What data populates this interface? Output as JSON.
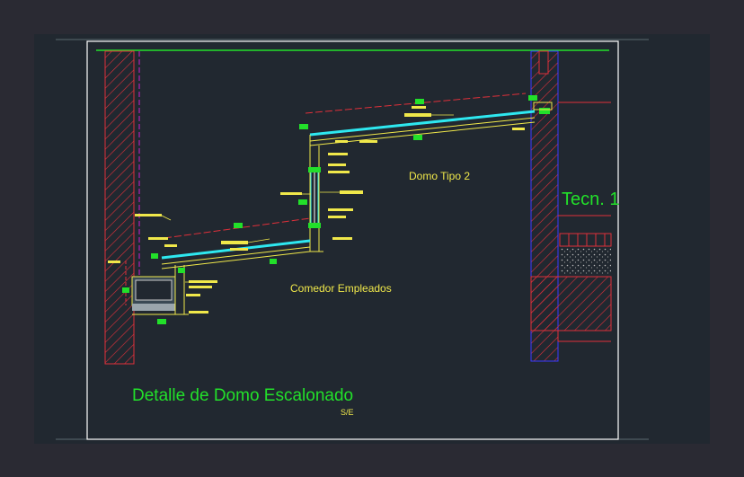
{
  "drawing": {
    "labels": {
      "room_upper": "Domo Tipo 2",
      "room_lower": "Comedor Empleados",
      "room_right": "Tecn. 1"
    },
    "title": "Detalle de Domo Escalonado",
    "scale": "S/E"
  },
  "colors": {
    "background": "#2a2a33",
    "sheet": "#212830",
    "border": "#ffffff",
    "hatch": "#e0303a",
    "glass": "#2ee8f0",
    "annotation": "#f0e84a",
    "tag": "#22e02a",
    "axis": "#d020d0",
    "wall_outline": "#3a3aff"
  }
}
